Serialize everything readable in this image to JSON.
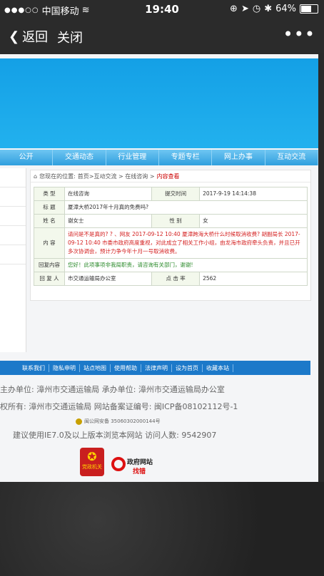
{
  "statusbar": {
    "carrier": "中国移动",
    "time": "19:40",
    "battery": "64%",
    "battery_level": 0.64
  },
  "navbar": {
    "back_label": "返回",
    "close_label": "关闭"
  },
  "menu": [
    "公开",
    "交通动态",
    "行业管理",
    "专题专栏",
    "网上办事",
    "互动交流"
  ],
  "breadcrumb": {
    "prefix": "您现在的位置:",
    "path": "首页>互动交流 > 在线咨询 >",
    "current": "内容查看"
  },
  "detail": {
    "type_label": "类    型",
    "type_value": "在线咨询",
    "submit_label": "提交时间",
    "submit_value": "2017-9-19 14:14:38",
    "title_label": "标    题",
    "title_value": "厦漳大桥2017年十月真的免费吗?",
    "name_label": "姓    名",
    "name_value": "谢女士",
    "gender_label": "性    别",
    "gender_value": "女",
    "content_label": "内    容",
    "content_value": "请问是不是真的? ? 、网友 2017-09-12 10:40 厦漳跨海大桥什么时候取消收费? 胡副局长 2017-09-12 10:40 市委市政府高度重视，对此成立了相关工作小组，由龙海市政府牵头负责，并且已开多次协调会，预计力争今年十月一号取消收费。",
    "reply_content_label": "回复内容",
    "reply_content_value": "您好！此项事项非我局职责，请咨询有关部门，谢谢!",
    "replier_label": "回 复 人",
    "replier_value": "市交通运输局办公室",
    "clicks_label": "点 击 率",
    "clicks_value": "2562"
  },
  "footer_nav": [
    "联系我们",
    "隐私申明",
    "站点地图",
    "使用帮助",
    "法律声明",
    "设为首页",
    "收藏本站"
  ],
  "footer": {
    "line1": "主办单位: 漳州市交通运输局    承办单位: 漳州市交通运输局办公室",
    "line2": "权所有: 漳州市交通运输局    网站备案证编号: 闽ICP备08102112号-1",
    "police": "闽公网安备 35060302000144号",
    "line4": "建议使用IE7.0及以上版本浏览本网站   访问人数: 9542907",
    "logo1_text": "党政机关",
    "logo2_line1": "政府网站",
    "logo2_line2": "找错"
  }
}
